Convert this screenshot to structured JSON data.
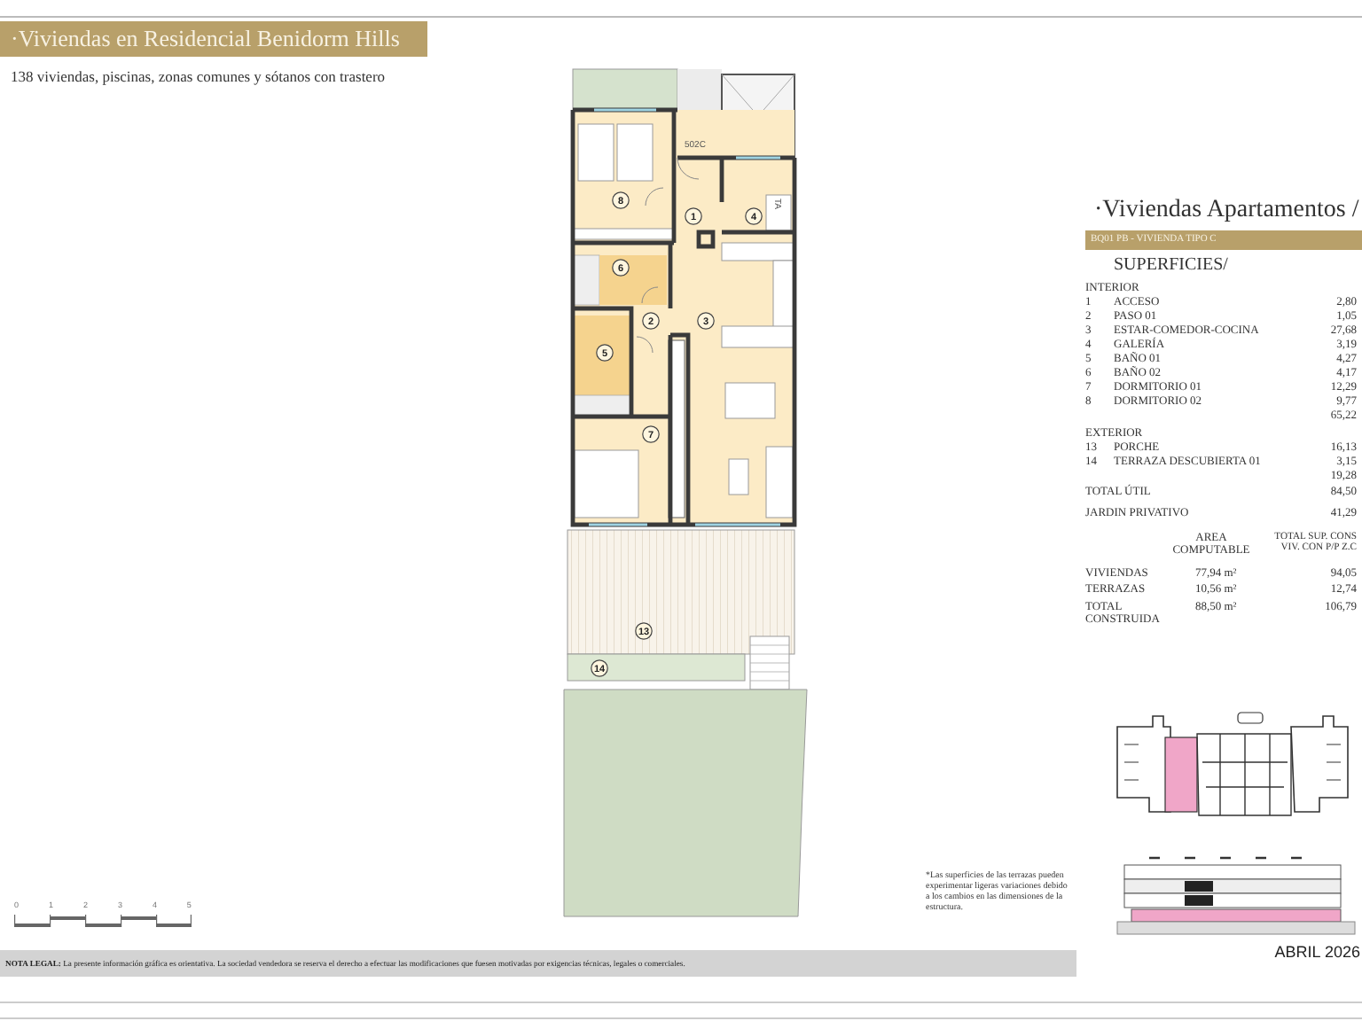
{
  "header": {
    "title": "·Viviendas en Residencial Benidorm Hills",
    "subtitle": "138 viviendas, piscinas, zonas comunes y sótanos con trastero"
  },
  "floor_plan": {
    "room_labels": [
      "8",
      "1",
      "4",
      "6",
      "2",
      "3",
      "5",
      "7",
      "13",
      "14"
    ],
    "unit_tag": "502C",
    "meter_tag": "TA"
  },
  "scale_bar": {
    "ticks": [
      "0",
      "1",
      "2",
      "3",
      "4",
      "5"
    ]
  },
  "areas": {
    "title": "·Viviendas Apartamentos /",
    "unit": "BQ01 PB - VIVIENDA TIPO C",
    "heading": "SUPERFICIES/",
    "groups": [
      {
        "heading": "INTERIOR",
        "rooms": [
          {
            "number": "1",
            "name": "ACCESO",
            "area": "2,80"
          },
          {
            "number": "2",
            "name": "PASO 01",
            "area": "1,05"
          },
          {
            "number": "3",
            "name": "ESTAR-COMEDOR-COCINA",
            "area": "27,68"
          },
          {
            "number": "4",
            "name": "GALERÍA",
            "area": "3,19"
          },
          {
            "number": "5",
            "name": "BAÑO 01",
            "area": "4,27"
          },
          {
            "number": "6",
            "name": "BAÑO 02",
            "area": "4,17"
          },
          {
            "number": "7",
            "name": "DORMITORIO 01",
            "area": "12,29"
          },
          {
            "number": "8",
            "name": "DORMITORIO 02",
            "area": "9,77"
          }
        ],
        "subtotal": "65,22"
      },
      {
        "heading": "EXTERIOR",
        "rooms": [
          {
            "number": "13",
            "name": "PORCHE",
            "area": "16,13"
          },
          {
            "number": "14",
            "name": "TERRAZA DESCUBIERTA 01",
            "area": "3,15"
          }
        ],
        "subtotal": "19,28"
      }
    ],
    "totals": [
      {
        "label": "TOTAL ÚTIL",
        "value": "84,50"
      },
      {
        "label": "JARDIN PRIVATIVO",
        "value": "41,29"
      }
    ],
    "computable": {
      "columns": [
        "AREA\nCOMPUTABLE",
        "TOTAL SUP. CONS\nVIV. CON P/P Z.C"
      ],
      "rows": [
        {
          "label": "VIVIENDAS",
          "values": [
            "77,94 m²",
            "94,05"
          ]
        },
        {
          "label": "TERRAZAS",
          "values": [
            "10,56 m²",
            "12,74"
          ]
        },
        {
          "label": "TOTAL\nCONSTRUIDA",
          "values": [
            "88,50 m²",
            "106,79"
          ]
        }
      ]
    }
  },
  "footnote": "*Las superficies de las terrazas pueden experimentar ligeras variaciones debido a los cambios en las dimensiones de la estructura.",
  "date": "ABRIL 2026",
  "legal_note": "**NOTA LEGAL:** La presente información gráfica es orientativa. La sociedad vendedora se reserva el derecho a efectuar las modificaciones que fuesen motivadas por exigencias técnicas, legales o comerciales."
}
